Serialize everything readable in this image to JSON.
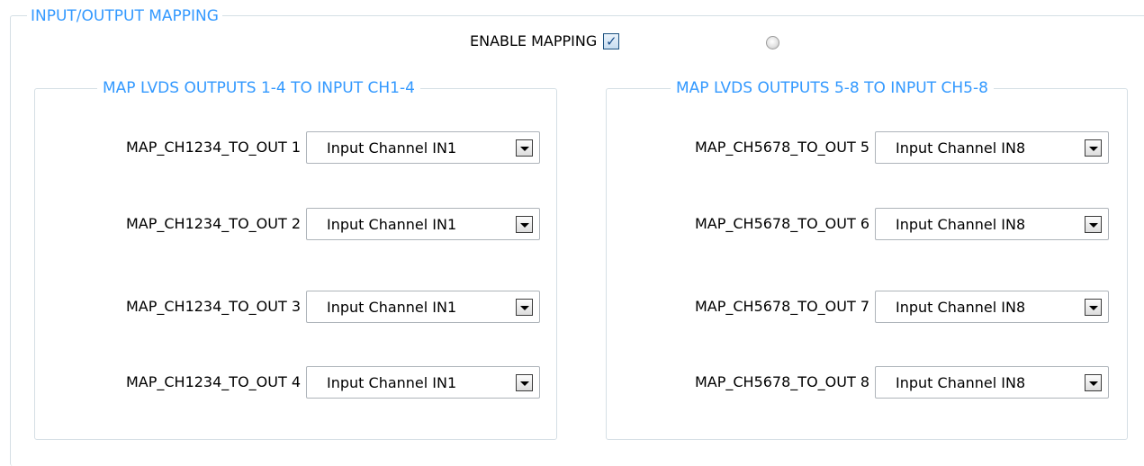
{
  "group": {
    "title": "INPUT/OUTPUT MAPPING"
  },
  "enable": {
    "label": "ENABLE MAPPING",
    "checked": true,
    "check_glyph": "✓"
  },
  "left": {
    "title": "MAP LVDS OUTPUTS 1-4 TO INPUT CH1-4",
    "rows": [
      {
        "label": "MAP_CH1234_TO_OUT 1",
        "value": "Input Channel IN1"
      },
      {
        "label": "MAP_CH1234_TO_OUT 2",
        "value": "Input Channel IN1"
      },
      {
        "label": "MAP_CH1234_TO_OUT 3",
        "value": "Input Channel IN1"
      },
      {
        "label": "MAP_CH1234_TO_OUT 4",
        "value": "Input Channel IN1"
      }
    ]
  },
  "right": {
    "title": "MAP LVDS OUTPUTS 5-8 TO INPUT CH5-8",
    "rows": [
      {
        "label": "MAP_CH5678_TO_OUT 5",
        "value": "Input Channel IN8"
      },
      {
        "label": "MAP_CH5678_TO_OUT 6",
        "value": "Input Channel IN8"
      },
      {
        "label": "MAP_CH5678_TO_OUT 7",
        "value": "Input Channel IN8"
      },
      {
        "label": "MAP_CH5678_TO_OUT 8",
        "value": "Input Channel IN8"
      }
    ]
  },
  "colors": {
    "group_title": "#3399ff",
    "border": "#d5dfe5"
  }
}
